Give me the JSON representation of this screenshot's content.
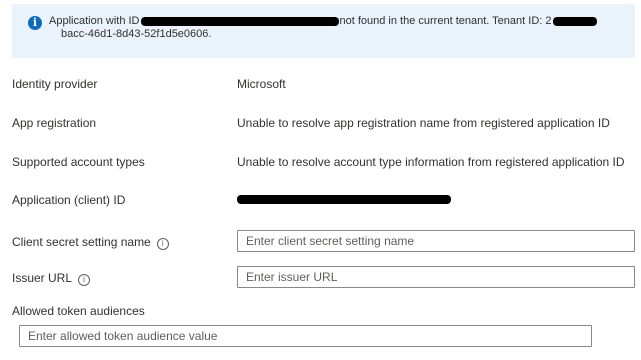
{
  "banner": {
    "line1_prefix": "Application with ID",
    "line1_suffix": "not found in the current tenant. Tenant ID: 2",
    "line2": "bacc-46d1-8d43-52f1d5e0606."
  },
  "identity_provider": {
    "label": "Identity provider",
    "value": "Microsoft"
  },
  "app_registration": {
    "label": "App registration",
    "value": "Unable to resolve app registration name from registered application ID"
  },
  "supported_account_types": {
    "label": "Supported account types",
    "value": "Unable to resolve account type information from registered application ID"
  },
  "application_client_id": {
    "label": "Application (client) ID"
  },
  "client_secret_setting": {
    "label": "Client secret setting name",
    "placeholder": "Enter client secret setting name",
    "value": ""
  },
  "issuer_url": {
    "label": "Issuer URL",
    "placeholder": "Enter issuer URL",
    "value": ""
  },
  "allowed_token_audiences": {
    "label": "Allowed token audiences",
    "placeholder": "Enter allowed token audience value",
    "value": ""
  }
}
